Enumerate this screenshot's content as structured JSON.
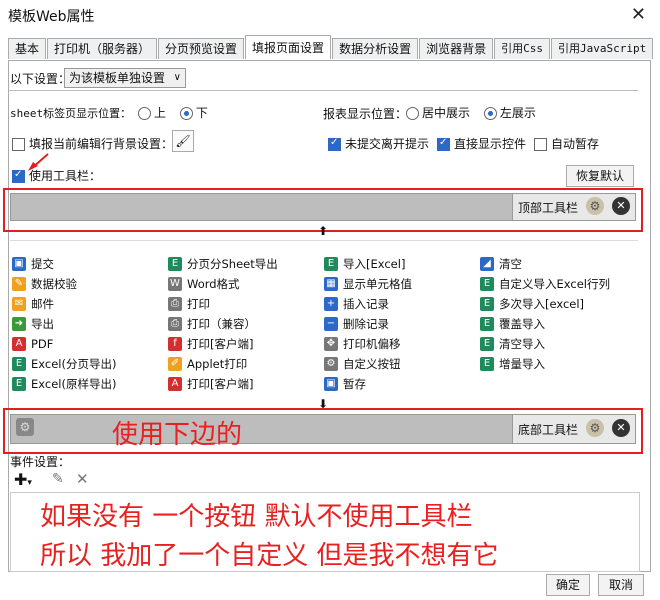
{
  "window": {
    "title": "模板Web属性"
  },
  "tabs": [
    "基本",
    "打印机（服务器）",
    "分页预览设置",
    "填报页面设置",
    "数据分析设置",
    "浏览器背景",
    "引用Css",
    "引用JavaScript"
  ],
  "settings": {
    "scope_label": "以下设置：",
    "scope_value": "为该模板单独设置",
    "sheet_tab_label": "sheet标签页显示位置：",
    "sheet_tab_opt_top": "上",
    "sheet_tab_opt_bottom": "下",
    "report_pos_label": "报表显示位置：",
    "report_pos_center": "居中展示",
    "report_pos_left": "左展示",
    "fill_bg_label": "填报当前编辑行背景设置：",
    "unsubmitted_label": "未提交离开提示",
    "show_controls_label": "直接显示控件",
    "autosave_label": "自动暂存",
    "use_toolbar_label": "使用工具栏：",
    "restore_default": "恢复默认"
  },
  "toolbars": {
    "top_label": "顶部工具栏",
    "bottom_label": "底部工具栏"
  },
  "buttons": [
    {
      "label": "提交",
      "icon": "save"
    },
    {
      "label": "分页分Sheet导出",
      "icon": "excel"
    },
    {
      "label": "导入[Excel]",
      "icon": "excel"
    },
    {
      "label": "清空",
      "icon": "eraser"
    },
    {
      "label": "数据校验",
      "icon": "pencil"
    },
    {
      "label": "Word格式",
      "icon": "word"
    },
    {
      "label": "显示单元格值",
      "icon": "cell"
    },
    {
      "label": "自定义导入Excel行列",
      "icon": "excel"
    },
    {
      "label": "邮件",
      "icon": "mail"
    },
    {
      "label": "打印",
      "icon": "printer"
    },
    {
      "label": "插入记录",
      "icon": "insert"
    },
    {
      "label": "多次导入[excel]",
      "icon": "excel"
    },
    {
      "label": "导出",
      "icon": "export"
    },
    {
      "label": "打印（兼容）",
      "icon": "printer"
    },
    {
      "label": "删除记录",
      "icon": "delete"
    },
    {
      "label": "覆盖导入",
      "icon": "excel"
    },
    {
      "label": "PDF",
      "icon": "pdf"
    },
    {
      "label": "打印[客户端]",
      "icon": "flash"
    },
    {
      "label": "打印机偏移",
      "icon": "move"
    },
    {
      "label": "清空导入",
      "icon": "excel"
    },
    {
      "label": "Excel(分页导出)",
      "icon": "excel"
    },
    {
      "label": "Applet打印",
      "icon": "applet"
    },
    {
      "label": "自定义按钮",
      "icon": "gear"
    },
    {
      "label": "增量导入",
      "icon": "excel"
    },
    {
      "label": "Excel(原样导出)",
      "icon": "excel"
    },
    {
      "label": "打印[客户端]",
      "icon": "pdf"
    },
    {
      "label": "暂存",
      "icon": "save"
    },
    {
      "label": "",
      "icon": ""
    }
  ],
  "annotations": {
    "bottom_note": "使用下边的",
    "note_line1": "如果没有 一个按钮 默认不使用工具栏",
    "note_line2": "所以 我加了一个自定义 但是我不想有它"
  },
  "events": {
    "label": "事件设置："
  },
  "footer": {
    "ok": "确定",
    "cancel": "取消"
  }
}
